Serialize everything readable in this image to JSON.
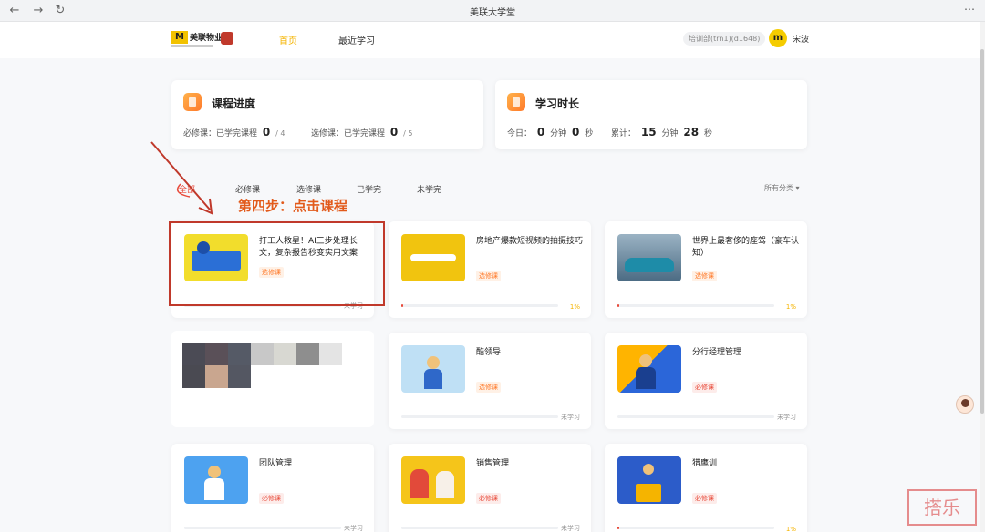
{
  "browser": {
    "title": "美联大学堂",
    "back": "←",
    "forward": "→",
    "reload": "↻",
    "more": "⋯"
  },
  "header": {
    "logo_text": "美联物业",
    "nav_home": "首页",
    "nav_recent": "最近学习",
    "user_code": "培训部(trn1)(d1648)",
    "avatar_letter": "m",
    "user_name": "宋波"
  },
  "stats": {
    "progress": {
      "title": "课程进度",
      "required_label": "必修课：已学完课程",
      "required_done": "0",
      "required_total": "/ 4",
      "elective_label": "选修课：已学完课程",
      "elective_done": "0",
      "elective_total": "/ 5"
    },
    "time": {
      "title": "学习时长",
      "today_label": "今日：",
      "today_min": "0",
      "min_unit": "分钟",
      "today_sec": "0",
      "sec_unit": "秒",
      "total_label": "累计：",
      "total_min": "15",
      "total_sec": "28"
    }
  },
  "filters": {
    "all": "全部",
    "required": "必修课",
    "elective": "选修课",
    "finished": "已学完",
    "unfinished": "未学完",
    "category": "所有分类 ▾"
  },
  "annotation": {
    "text": "第四步：点击课程"
  },
  "courses": [
    {
      "title": "打工人救星！AI三步处理长文，复杂报告秒变实用文案",
      "tag": "选修课",
      "status": "未学习",
      "progress": 0
    },
    {
      "title": "房地产爆款短视频的拍摄技巧",
      "tag": "选修课",
      "status": "1%",
      "progress": 1
    },
    {
      "title": "世界上最奢侈的座驾（豪车认知）",
      "tag": "选修课",
      "status": "1%",
      "progress": 1
    },
    {
      "title": "酷领导",
      "tag": "选修课",
      "status": "未学习",
      "progress": 0
    },
    {
      "title": "分行经理管理",
      "tag": "必修课",
      "status": "未学习",
      "progress": 0
    },
    {
      "title": "团队管理",
      "tag": "必修课",
      "status": "未学习",
      "progress": 0
    },
    {
      "title": "销售管理",
      "tag": "必修课",
      "status": "未学习",
      "progress": 0
    },
    {
      "title": "猎鹰训",
      "tag": "必修课",
      "status": "1%",
      "progress": 1
    }
  ],
  "watermark": "搭乐",
  "colors": {
    "accent": "#f5b400",
    "active_filter": "#e84a3a",
    "annotation": "#e25a1b",
    "highlight_box": "#c0392b"
  }
}
